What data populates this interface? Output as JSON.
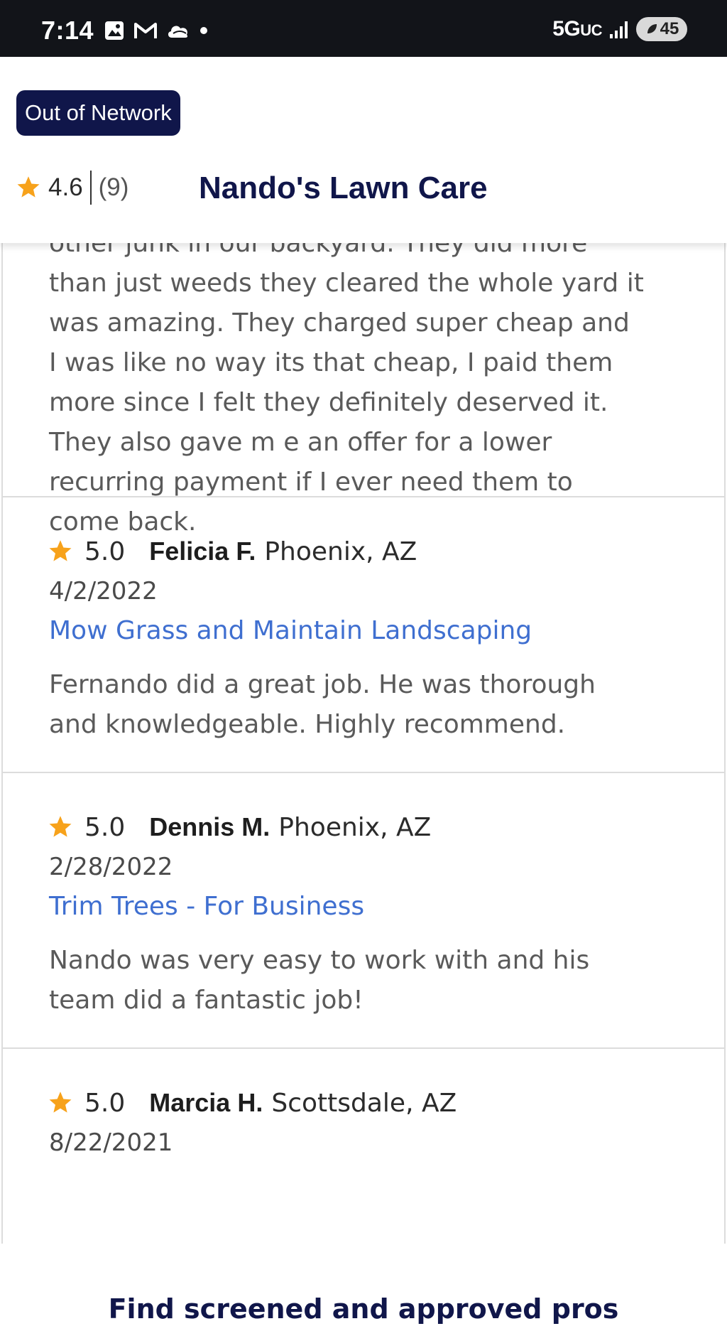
{
  "status_bar": {
    "time": "7:14",
    "network": "5G",
    "network_sub": "UC",
    "battery": "45",
    "icons": [
      "gallery-icon",
      "gmail-icon",
      "cloud-icon",
      "dot-icon",
      "signal-icon",
      "battery-icon"
    ]
  },
  "header": {
    "badge": "Out of Network",
    "rating": "4.6",
    "review_count": "(9)",
    "business_name": "Nando's Lawn Care"
  },
  "colors": {
    "navy": "#10164a",
    "star": "#f7a21b",
    "link": "#3f6fd0"
  },
  "reviews": [
    {
      "text_lines": [
        "other junk in our backyard. They did more",
        "than just weeds they cleared the whole yard it",
        "was amazing. They charged super cheap and",
        "I was like no way its that cheap, I paid them",
        "more since I felt they definitely deserved it.",
        "They also gave m e an offer for a lower",
        "recurring payment if I ever need them to",
        "come back."
      ]
    },
    {
      "score": "5.0",
      "name": "Felicia F.",
      "location": "Phoenix, AZ",
      "date": "4/2/2022",
      "service": "Mow Grass and Maintain Landscaping",
      "text_lines": [
        "Fernando did a great job. He was thorough",
        "and knowledgeable. Highly recommend."
      ]
    },
    {
      "score": "5.0",
      "name": "Dennis M.",
      "location": "Phoenix, AZ",
      "date": "2/28/2022",
      "service": "Trim Trees - For Business",
      "text_lines": [
        "Nando was very easy to work with and his",
        "team did a fantastic job!"
      ]
    },
    {
      "score": "5.0",
      "name": "Marcia H.",
      "location": "Scottsdale, AZ",
      "date": "8/22/2021"
    }
  ],
  "footer": {
    "link": "Find screened and approved pros"
  }
}
